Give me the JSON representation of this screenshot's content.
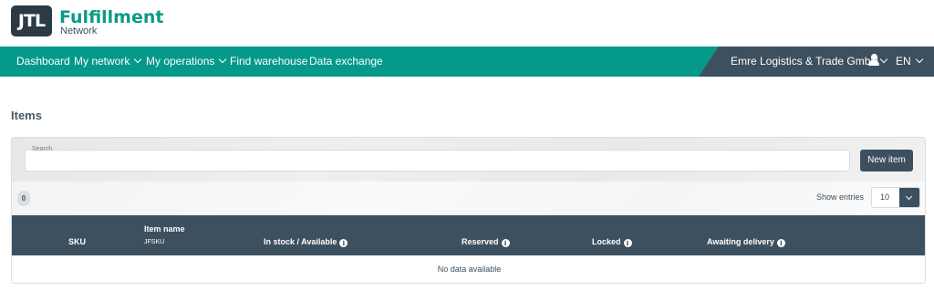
{
  "brand": {
    "mark": "JTL",
    "title": "Fulfillment",
    "subtitle": "Network",
    "color": "#0a9a86"
  },
  "nav": {
    "items": [
      {
        "label": "Dashboard",
        "dropdown": false
      },
      {
        "label": "My network",
        "dropdown": true
      },
      {
        "label": "My operations",
        "dropdown": true
      },
      {
        "label": "Find warehouse",
        "dropdown": false
      },
      {
        "label": "Data exchange",
        "dropdown": false
      }
    ],
    "company": "Emre Logistics & Trade GmbH",
    "user_icon": "user-icon",
    "language": "EN",
    "colors": {
      "primary": "#05998a",
      "secondary": "#3c5060"
    }
  },
  "page": {
    "title": "Items"
  },
  "search": {
    "label": "Search",
    "value": "",
    "new_button": "New item"
  },
  "toolbar": {
    "count": "0",
    "show_entries_label": "Show entries",
    "entries_value": "10"
  },
  "table": {
    "columns": [
      {
        "label": "SKU",
        "info": false
      },
      {
        "label": "Item name",
        "sub": "JFSKU",
        "info": false
      },
      {
        "label": "In stock / Available",
        "info": true
      },
      {
        "label": "Reserved",
        "info": true
      },
      {
        "label": "Locked",
        "info": true
      },
      {
        "label": "Awaiting delivery",
        "info": true
      }
    ],
    "info_glyph": "i",
    "empty_text": "No data available"
  }
}
